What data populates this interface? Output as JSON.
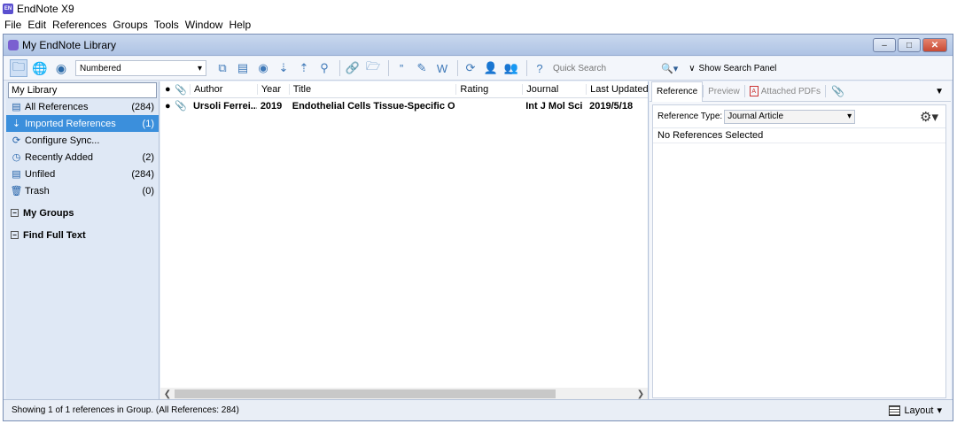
{
  "app": {
    "logo": "EN",
    "title": "EndNote X9"
  },
  "menu": [
    "File",
    "Edit",
    "References",
    "Groups",
    "Tools",
    "Window",
    "Help"
  ],
  "document": {
    "title": "My EndNote Library"
  },
  "toolbar": {
    "style": "Numbered",
    "quick_search_placeholder": "Quick Search",
    "show_search_panel": "Show Search Panel"
  },
  "groups": {
    "mode": "My Library",
    "items": [
      {
        "icon": "all-references-icon",
        "label": "All References",
        "count": "(284)"
      },
      {
        "icon": "imported-references-icon",
        "label": "Imported References",
        "count": "(1)"
      },
      {
        "icon": "sync-icon",
        "label": "Configure Sync...",
        "count": ""
      },
      {
        "icon": "recently-added-icon",
        "label": "Recently Added",
        "count": "(2)"
      },
      {
        "icon": "unfiled-icon",
        "label": "Unfiled",
        "count": "(284)"
      },
      {
        "icon": "trash-icon",
        "label": "Trash",
        "count": "(0)"
      }
    ],
    "sections": [
      "My Groups",
      "Find Full Text"
    ]
  },
  "references": {
    "columns": [
      "Author",
      "Year",
      "Title",
      "Rating",
      "Journal",
      "Last Updated"
    ],
    "rows": [
      {
        "author": "Ursoli Ferrei...",
        "year": "2019",
        "title": "Endothelial Cells Tissue-Specific Orig...",
        "rating": "",
        "journal": "Int J Mol Sci",
        "updated": "2019/5/18"
      }
    ],
    "scroll_fraction": 0.83
  },
  "right_panel": {
    "tabs": [
      "Reference",
      "Preview",
      "Attached PDFs"
    ],
    "reference_type_label": "Reference Type:",
    "reference_type": "Journal Article",
    "empty_message": "No References Selected"
  },
  "status": {
    "text": "Showing 1 of 1 references in Group. (All References: 284)",
    "layout_label": "Layout"
  },
  "colors": {
    "selection": "#3b8fdc",
    "pane_bg": "#dfe8f5",
    "titlebar": "#aec3e4",
    "close": "#c84a33"
  }
}
